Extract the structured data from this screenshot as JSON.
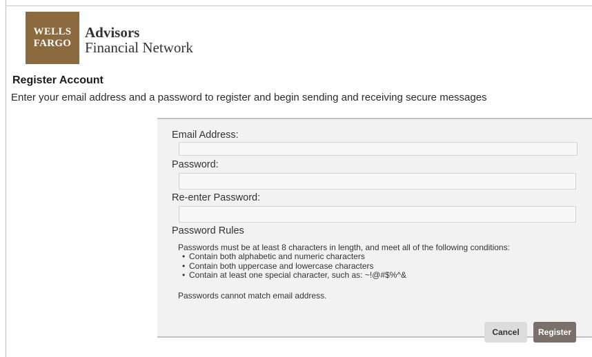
{
  "brand": {
    "logo_line1": "WELLS",
    "logo_line2": "FARGO",
    "name_line1": "Advisors",
    "name_line2": "Financial Network",
    "logo_color": "#8a6a3e"
  },
  "header": {
    "title": "Register Account",
    "description": "Enter your email address and a password to register and begin sending and receiving secure messages"
  },
  "form": {
    "email_label": "Email Address:",
    "email_value": "",
    "password_label": "Password:",
    "password_value": "",
    "reenter_label": "Re-enter Password:",
    "reenter_value": ""
  },
  "rules": {
    "title": "Password Rules",
    "intro": "Passwords must be at least 8 characters in length, and meet all of the following conditions:",
    "items": [
      "Contain both alphabetic and numeric characters",
      "Contain both uppercase and lowercase characters",
      "Contain at least one special character, such as: ~!@#$%^&"
    ],
    "note": "Passwords cannot match email address."
  },
  "actions": {
    "cancel_label": "Cancel",
    "register_label": "Register",
    "register_color": "#7b6f6c"
  }
}
